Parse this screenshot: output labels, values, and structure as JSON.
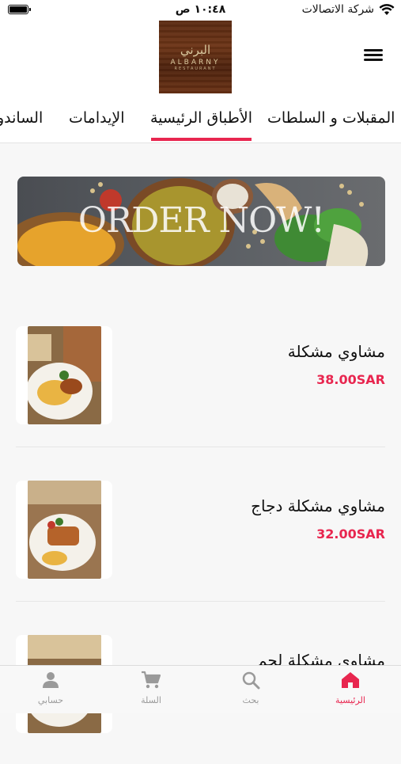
{
  "status_bar": {
    "carrier": "شركة الاتصالات",
    "time": "١٠:٤٨ ص"
  },
  "header": {
    "logo_text_ar": "البرني",
    "logo_text_en": "ALBARNY",
    "logo_subtext": "RESTAURANT",
    "menu_icon": "hamburger-icon"
  },
  "tabs": [
    {
      "label": "المقبلات و السلطات"
    },
    {
      "label": "الأطباق الرئيسية",
      "active": true
    },
    {
      "label": "الإيدامات"
    },
    {
      "label": "الساندو"
    }
  ],
  "banner": {
    "text": "ORDER NOW!"
  },
  "menu_items": [
    {
      "name": "مشاوي مشكلة",
      "price": "38.00SAR"
    },
    {
      "name": "مشاوي مشكلة دجاج",
      "price": "32.00SAR"
    },
    {
      "name": "مشاوي مشكلة لحم",
      "price": ""
    }
  ],
  "bottom_nav": [
    {
      "label": "الرئيسية",
      "icon": "home-icon",
      "active": true
    },
    {
      "label": "بحث",
      "icon": "search-icon"
    },
    {
      "label": "السلة",
      "icon": "cart-icon"
    },
    {
      "label": "حسابي",
      "icon": "user-icon"
    }
  ],
  "colors": {
    "accent": "#e8264f",
    "background": "#f7f7f7",
    "inactive": "#9a9a9a"
  }
}
